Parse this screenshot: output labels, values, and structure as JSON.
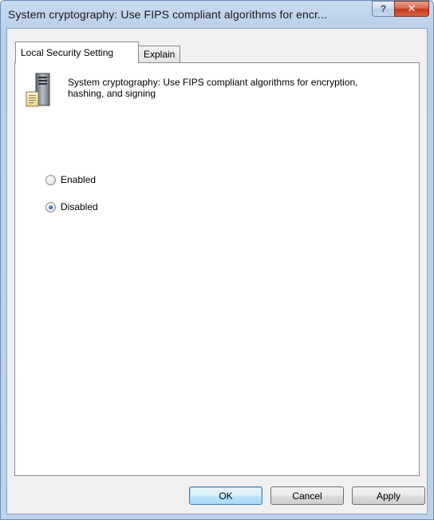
{
  "window": {
    "title": "System cryptography: Use FIPS compliant algorithms for encr...",
    "help_label": "?",
    "close_label": "✕"
  },
  "tabs": [
    {
      "label": "Local Security Setting",
      "active": true
    },
    {
      "label": "Explain",
      "active": false
    }
  ],
  "setting": {
    "icon": "server-icon",
    "title": "System cryptography: Use FIPS compliant algorithms for encryption, hashing, and signing"
  },
  "options": {
    "enabled_label": "Enabled",
    "disabled_label": "Disabled",
    "selected": "Disabled"
  },
  "buttons": {
    "ok_label": "OK",
    "cancel_label": "Cancel",
    "apply_label": "Apply"
  },
  "colors": {
    "accent": "#3c7fb1",
    "close_button": "#c3391c"
  }
}
